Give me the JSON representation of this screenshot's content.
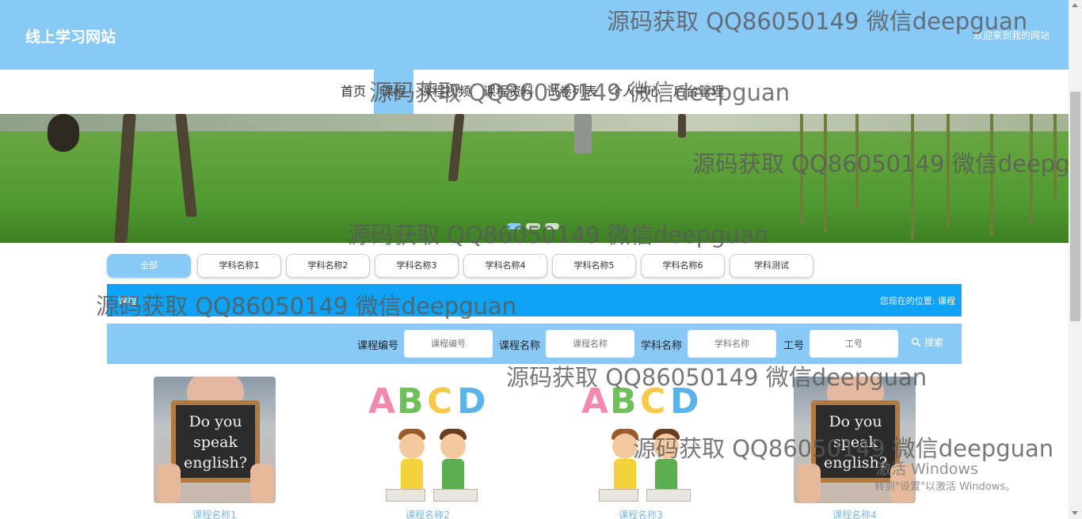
{
  "header": {
    "site_title": "线上学习网站",
    "welcome_text": "欢迎来到我的网站"
  },
  "nav": {
    "items": [
      {
        "label": "首页"
      },
      {
        "label": "课程"
      },
      {
        "label": "课程视频"
      },
      {
        "label": "课程资料"
      },
      {
        "label": "试卷列表"
      },
      {
        "label": "个人中心"
      },
      {
        "label": "后台管理"
      }
    ],
    "active_index": 1
  },
  "banner": {
    "slide_count": 3,
    "active_slide": 0
  },
  "subject_tabs": [
    "全部",
    "学科名称1",
    "学科名称2",
    "学科名称3",
    "学科名称4",
    "学科名称5",
    "学科名称6",
    "学科测试"
  ],
  "section": {
    "title": "课程",
    "location_prefix": "您现在的位置:",
    "location_current": "课程"
  },
  "search": {
    "fields": [
      {
        "label": "课程编号",
        "placeholder": "课程编号"
      },
      {
        "label": "课程名称",
        "placeholder": "课程名称"
      },
      {
        "label": "学科名称",
        "placeholder": "学科名称"
      },
      {
        "label": "工号",
        "placeholder": "工号"
      }
    ],
    "button_label": "搜索"
  },
  "courses": [
    {
      "name": "课程名称1",
      "image": "speak-english-board",
      "board_text": [
        "Do you",
        "speak",
        "english?"
      ]
    },
    {
      "name": "课程名称2",
      "image": "abcd-kids",
      "letters": [
        "A",
        "B",
        "C",
        "D"
      ]
    },
    {
      "name": "课程名称3",
      "image": "abcd-kids",
      "letters": [
        "A",
        "B",
        "C",
        "D"
      ]
    },
    {
      "name": "课程名称4",
      "image": "speak-english-board",
      "board_text": [
        "Do you",
        "speak",
        "english?"
      ]
    }
  ],
  "watermarks": [
    "源码获取 QQ86050149 微信deepguan",
    "源码获取 QQ86050149 微信deepguan",
    "源码获取 QQ86050149 微信deepguan",
    "源码获取 QQ86050149 微信deepguan",
    "源码获取 QQ86050149 微信deepguan",
    "源码获取 QQ86050149 微信deepguan",
    "源码获取 QQ86050149 微信deepguan"
  ],
  "os_overlay": {
    "line1": "激活 Windows",
    "line2": "转到\"设置\"以激活 Windows。"
  },
  "colors": {
    "header_bg": "#88c9f7",
    "section_bar": "#0ea3f5",
    "link": "#7ab7e8"
  }
}
